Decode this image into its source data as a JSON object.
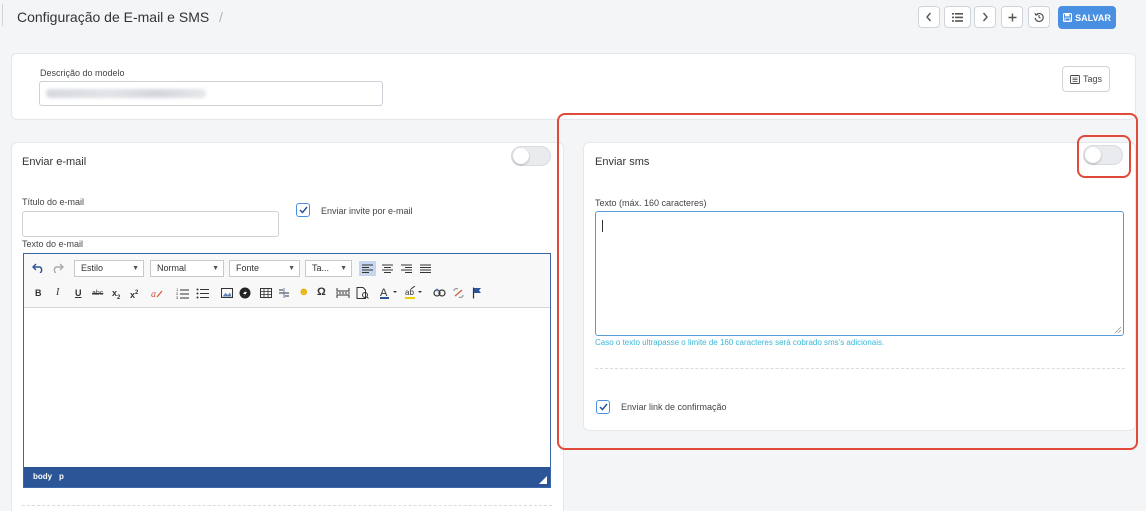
{
  "header": {
    "title": "Configuração de E-mail e SMS",
    "separator": "/",
    "save_label": "SALVAR",
    "buttons": [
      "chevron-left-icon",
      "list-icon",
      "chevron-right-icon",
      "plus-icon",
      "history-icon"
    ]
  },
  "model": {
    "description_label": "Descrição do modelo",
    "tags_label": "Tags"
  },
  "email": {
    "title": "Enviar e-mail",
    "toggle_on": false,
    "subject_label": "Título do e-mail",
    "subject_value": "",
    "invite_label": "Enviar invite por e-mail",
    "invite_checked": true,
    "body_label": "Texto do e-mail",
    "editor": {
      "style_combo": "Estilo",
      "format_combo": "Normal",
      "font_combo": "Fonte",
      "size_combo": "Ta...",
      "status_path": [
        "body",
        "p"
      ]
    }
  },
  "sms": {
    "title": "Enviar sms",
    "toggle_on": false,
    "text_label": "Texto (máx. 160 caracteres)",
    "text_value": "",
    "hint": "Caso o texto ultrapasse o limite de 160 caracteres será cobrado sms's adicionais.",
    "confirm_label": "Enviar link de confirmação",
    "confirm_checked": true
  },
  "colors": {
    "primary": "#4a90e2",
    "highlight": "#e04a3a",
    "hint": "#3ab7d6",
    "editor_bar": "#2c5597"
  }
}
